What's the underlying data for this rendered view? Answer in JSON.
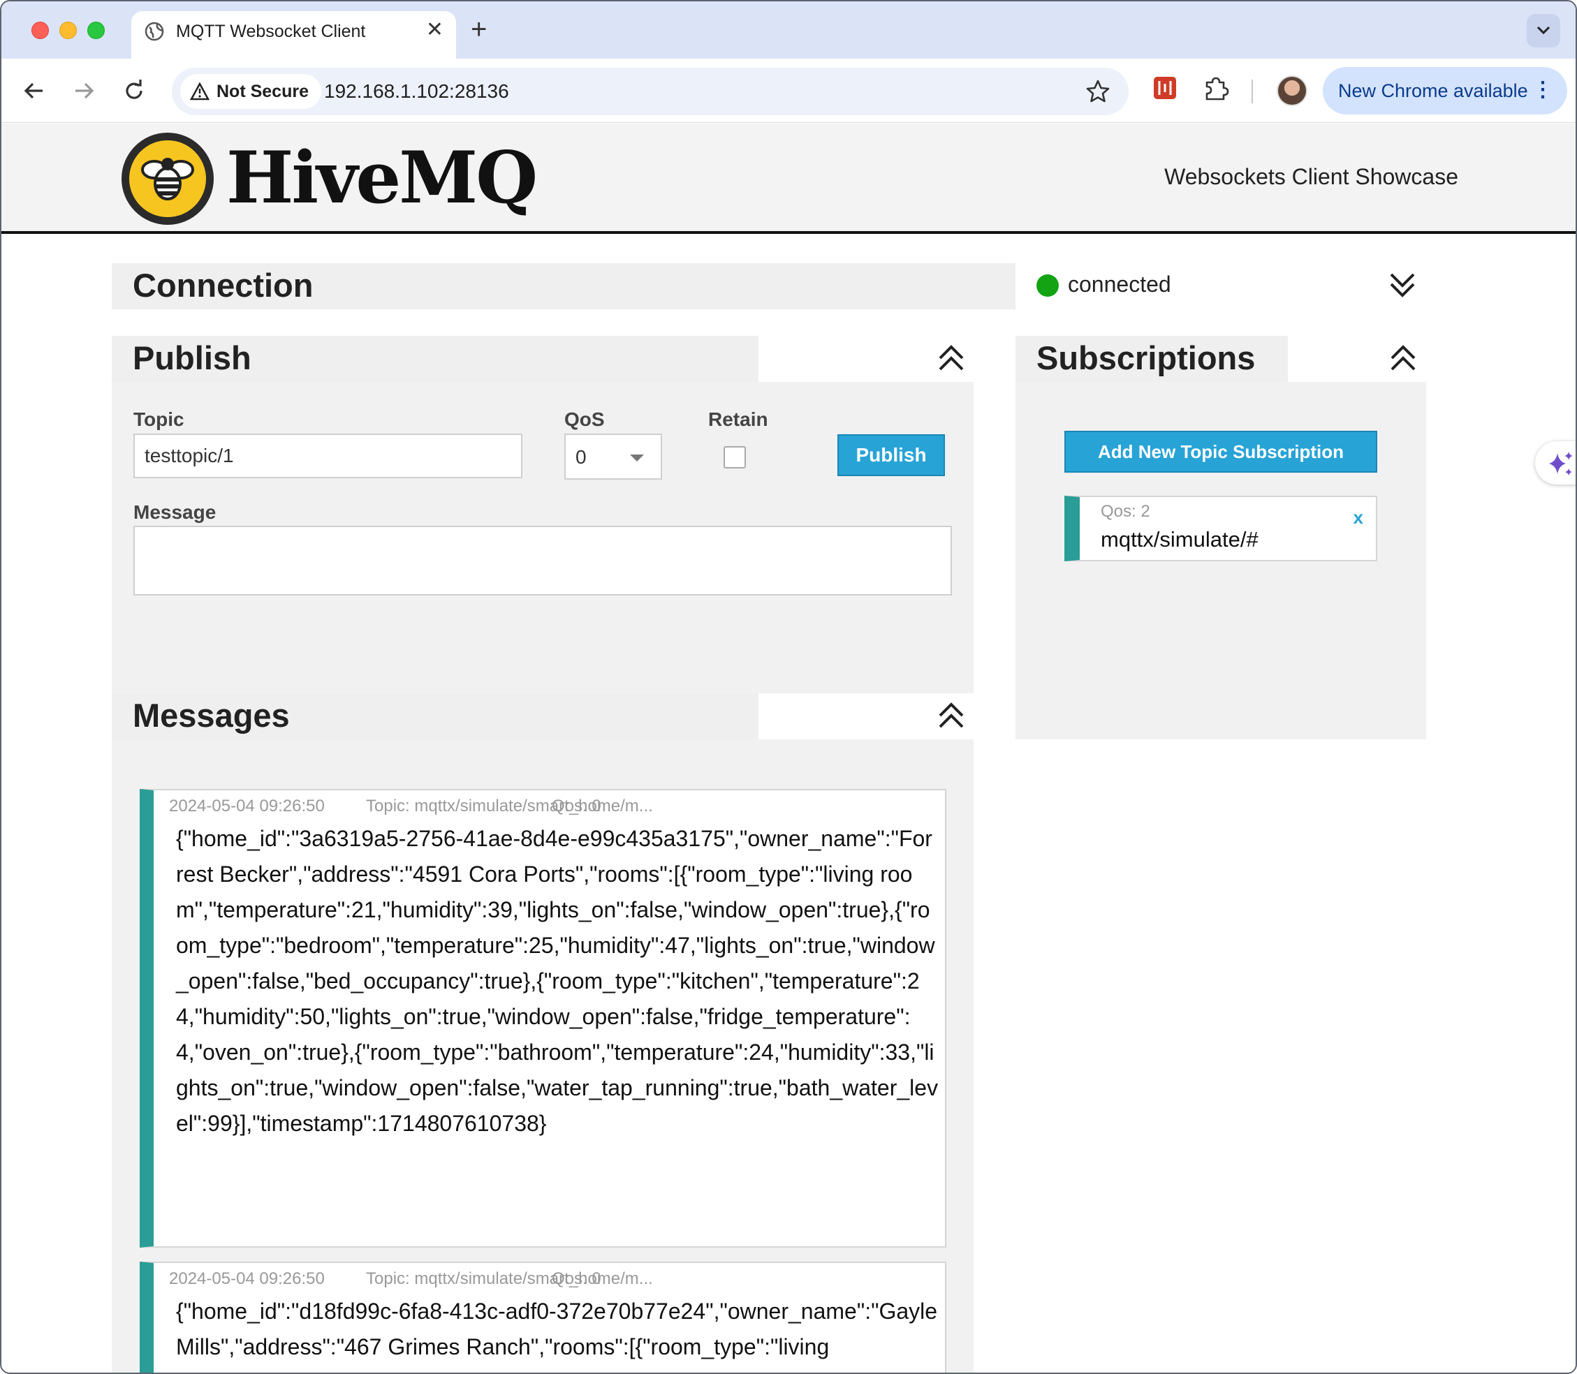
{
  "browser": {
    "tab_title": "MQTT Websocket Client",
    "security_label": "Not Secure",
    "url": "192.168.1.102:28136",
    "update_button": "New Chrome available"
  },
  "header": {
    "logo_text": "HiveMQ",
    "tagline": "Websockets Client Showcase"
  },
  "connection": {
    "title": "Connection",
    "status": "connected",
    "status_color": "#13a313"
  },
  "publish": {
    "title": "Publish",
    "topic_label": "Topic",
    "topic_value": "testtopic/1",
    "qos_label": "QoS",
    "qos_value": "0",
    "retain_label": "Retain",
    "retain_checked": false,
    "publish_button": "Publish",
    "message_label": "Message",
    "message_value": ""
  },
  "subscriptions": {
    "title": "Subscriptions",
    "add_button": "Add New Topic Subscription",
    "items": [
      {
        "qos": "Qos: 2",
        "topic": "mqttx/simulate/#",
        "remove": "x",
        "color": "#2a9d96"
      }
    ]
  },
  "messages": {
    "title": "Messages",
    "items": [
      {
        "time": "2024-05-04 09:26:50",
        "topic": "Topic: mqttx/simulate/smart_home/m...",
        "qos": "Qos: 0",
        "payload": "{\"home_id\":\"3a6319a5-2756-41ae-8d4e-e99c435a3175\",\"owner_name\":\"Forrest Becker\",\"address\":\"4591 Cora Ports\",\"rooms\":[{\"room_type\":\"living room\",\"temperature\":21,\"humidity\":39,\"lights_on\":false,\"window_open\":true},{\"room_type\":\"bedroom\",\"temperature\":25,\"humidity\":47,\"lights_on\":true,\"window_open\":false,\"bed_occupancy\":true},{\"room_type\":\"kitchen\",\"temperature\":24,\"humidity\":50,\"lights_on\":true,\"window_open\":false,\"fridge_temperature\":4,\"oven_on\":true},{\"room_type\":\"bathroom\",\"temperature\":24,\"humidity\":33,\"lights_on\":true,\"window_open\":false,\"water_tap_running\":true,\"bath_water_level\":99}],\"timestamp\":1714807610738}"
      },
      {
        "time": "2024-05-04 09:26:50",
        "topic": "Topic: mqttx/simulate/smart_home/m...",
        "qos": "Qos: 0",
        "payload": "{\"home_id\":\"d18fd99c-6fa8-413c-adf0-372e70b77e24\",\"owner_name\":\"Gayle Mills\",\"address\":\"467 Grimes Ranch\",\"rooms\":[{\"room_type\":\"living"
      }
    ]
  }
}
